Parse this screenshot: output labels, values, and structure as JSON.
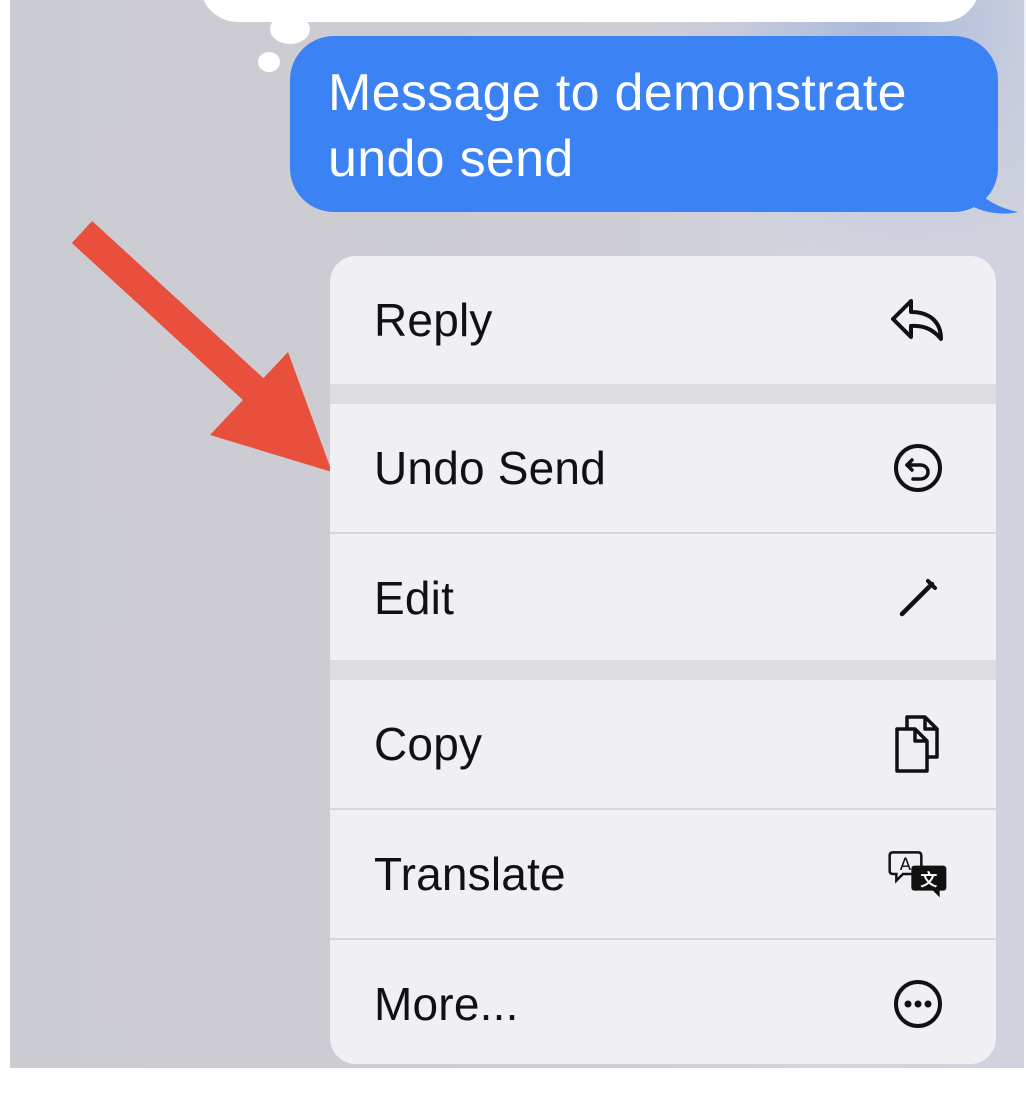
{
  "message": {
    "text": "Message to demonstrate undo send",
    "bubble_color": "#3b82f5"
  },
  "context_menu": {
    "items": [
      {
        "label": "Reply",
        "icon": "reply-icon"
      },
      {
        "label": "Undo Send",
        "icon": "undo-send-icon"
      },
      {
        "label": "Edit",
        "icon": "pencil-icon"
      },
      {
        "label": "Copy",
        "icon": "copy-icon"
      },
      {
        "label": "Translate",
        "icon": "translate-icon"
      },
      {
        "label": "More...",
        "icon": "ellipsis-circle-icon"
      }
    ]
  },
  "annotation": {
    "arrow_color": "#e8503d",
    "points_to": "Undo Send"
  }
}
